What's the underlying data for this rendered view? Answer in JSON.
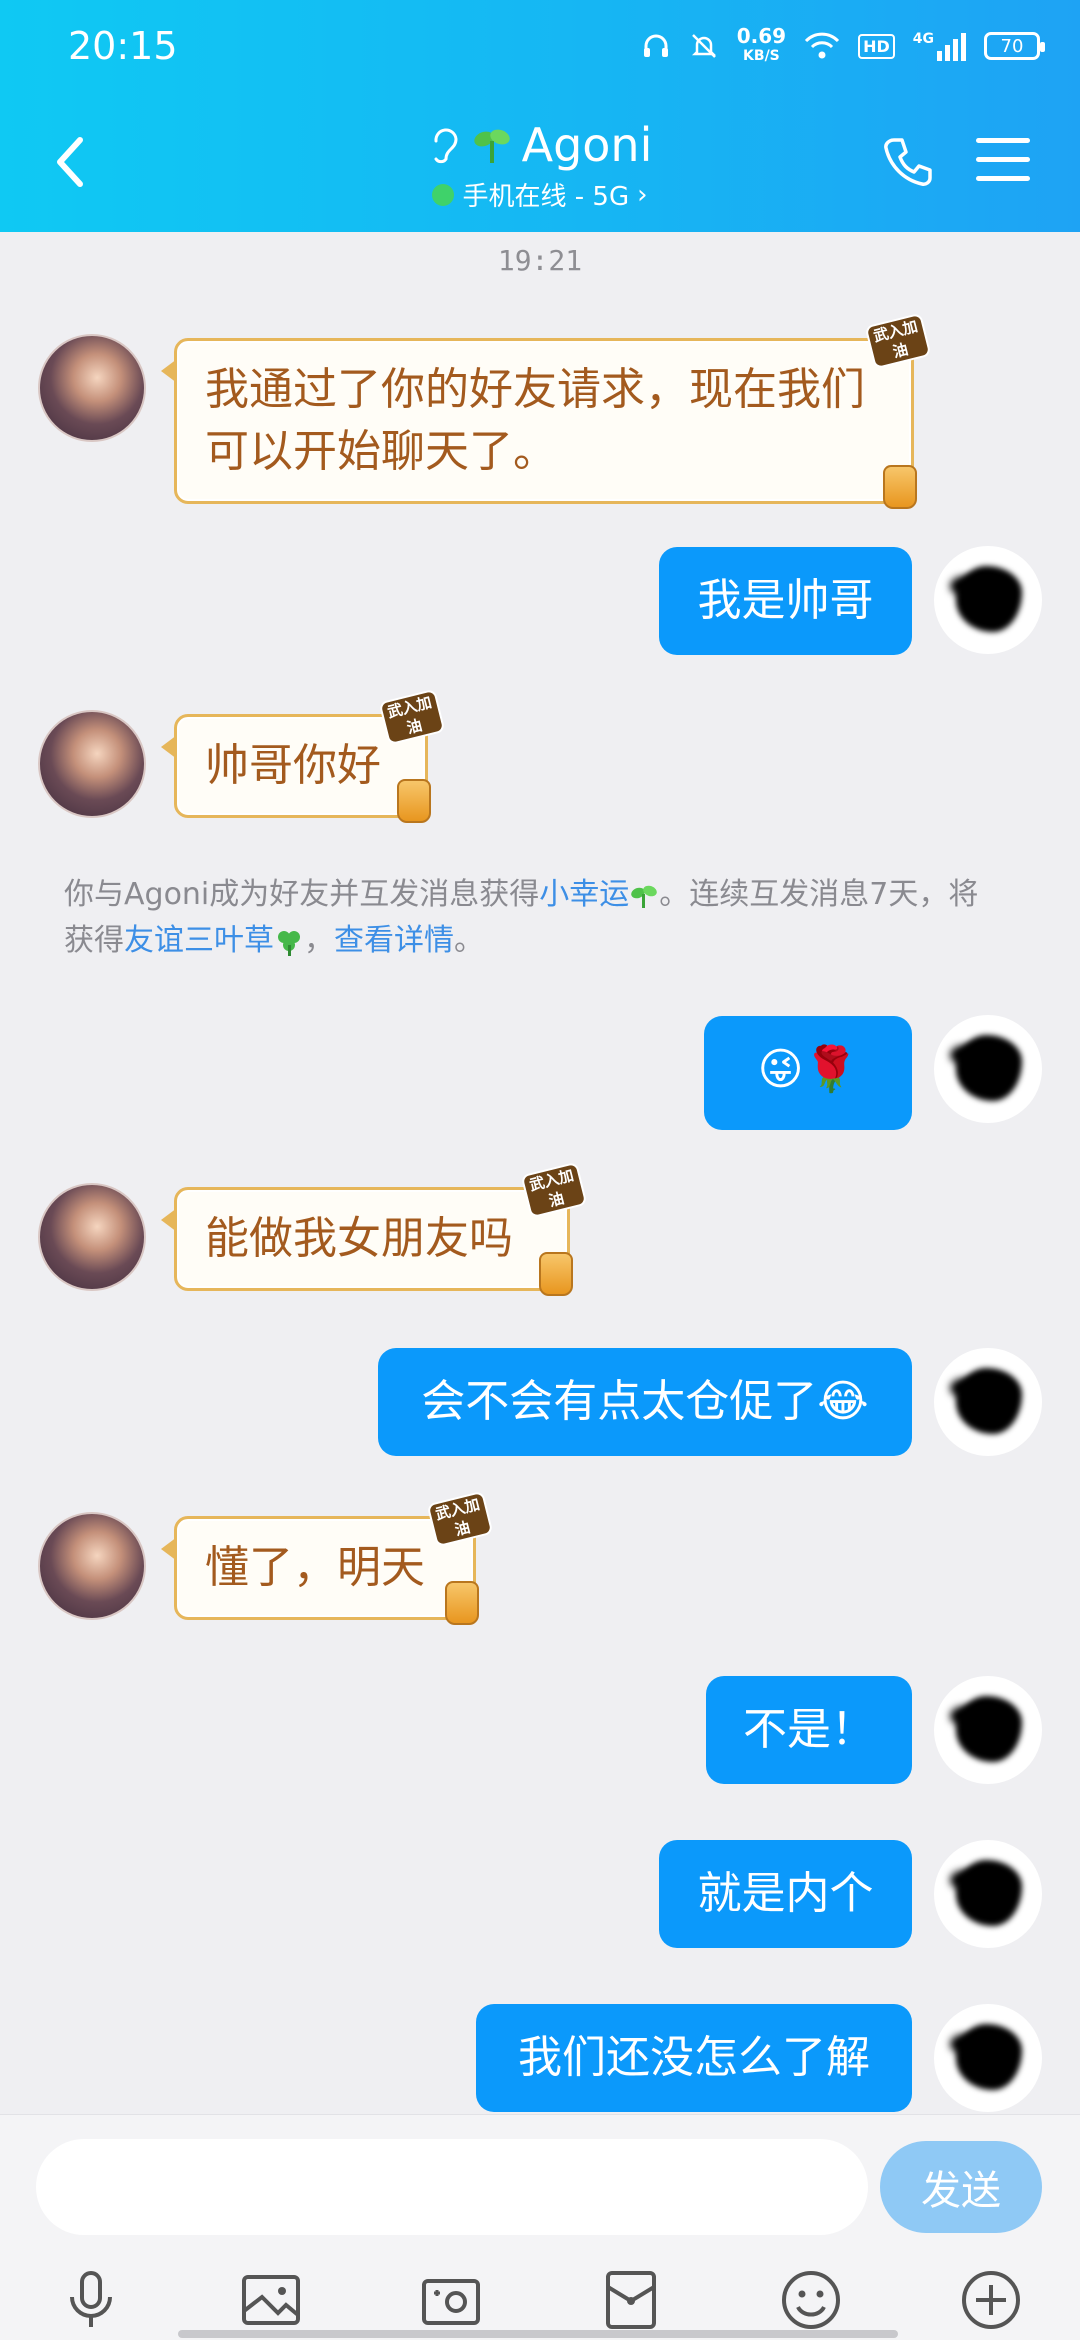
{
  "status_bar": {
    "time": "20:15",
    "speed_value": "0.69",
    "speed_unit": "KB/S",
    "hd": "HD",
    "network": "4G",
    "battery": "70"
  },
  "header": {
    "title": "Agoni",
    "subtitle": "手机在线 - 5G",
    "title_color": "#ffffff",
    "bg_start": "#0fc9f3",
    "bg_end": "#1ea3f4"
  },
  "timestamp": "19:21",
  "messages": [
    {
      "from": "other",
      "text": "我通过了你的好友请求，现在我们可以开始聊天了。"
    },
    {
      "from": "self",
      "text": "我是帅哥"
    },
    {
      "from": "other",
      "text": "帅哥你好"
    },
    {
      "from": "self",
      "text": "😜🌹"
    },
    {
      "from": "other",
      "text": "能做我女朋友吗"
    },
    {
      "from": "self",
      "text": "会不会有点太仓促了😂"
    },
    {
      "from": "other",
      "text": "懂了，明天"
    },
    {
      "from": "self",
      "text": "不是！"
    },
    {
      "from": "self",
      "text": "就是内个"
    },
    {
      "from": "self",
      "text": "我们还没怎么了解"
    }
  ],
  "badge_text": "武入加油",
  "notice": {
    "part1": "你与Agoni成为好友并互发消息获得",
    "link1": "小幸运",
    "part2": "。连续互发消息7天，将获得",
    "link2": "友谊三叶草",
    "part3": "，",
    "link3": "查看详情",
    "part4": "。"
  },
  "input": {
    "placeholder": "",
    "send_label": "发送"
  },
  "toolbar_icons": [
    "microphone-icon",
    "image-icon",
    "camera-icon",
    "red-packet-icon",
    "emoji-icon",
    "plus-icon"
  ],
  "colors": {
    "self_bubble": "#0b99fb",
    "other_text": "#a35a1e",
    "link": "#3d8fe6",
    "send_btn": "#8fc9f5"
  }
}
